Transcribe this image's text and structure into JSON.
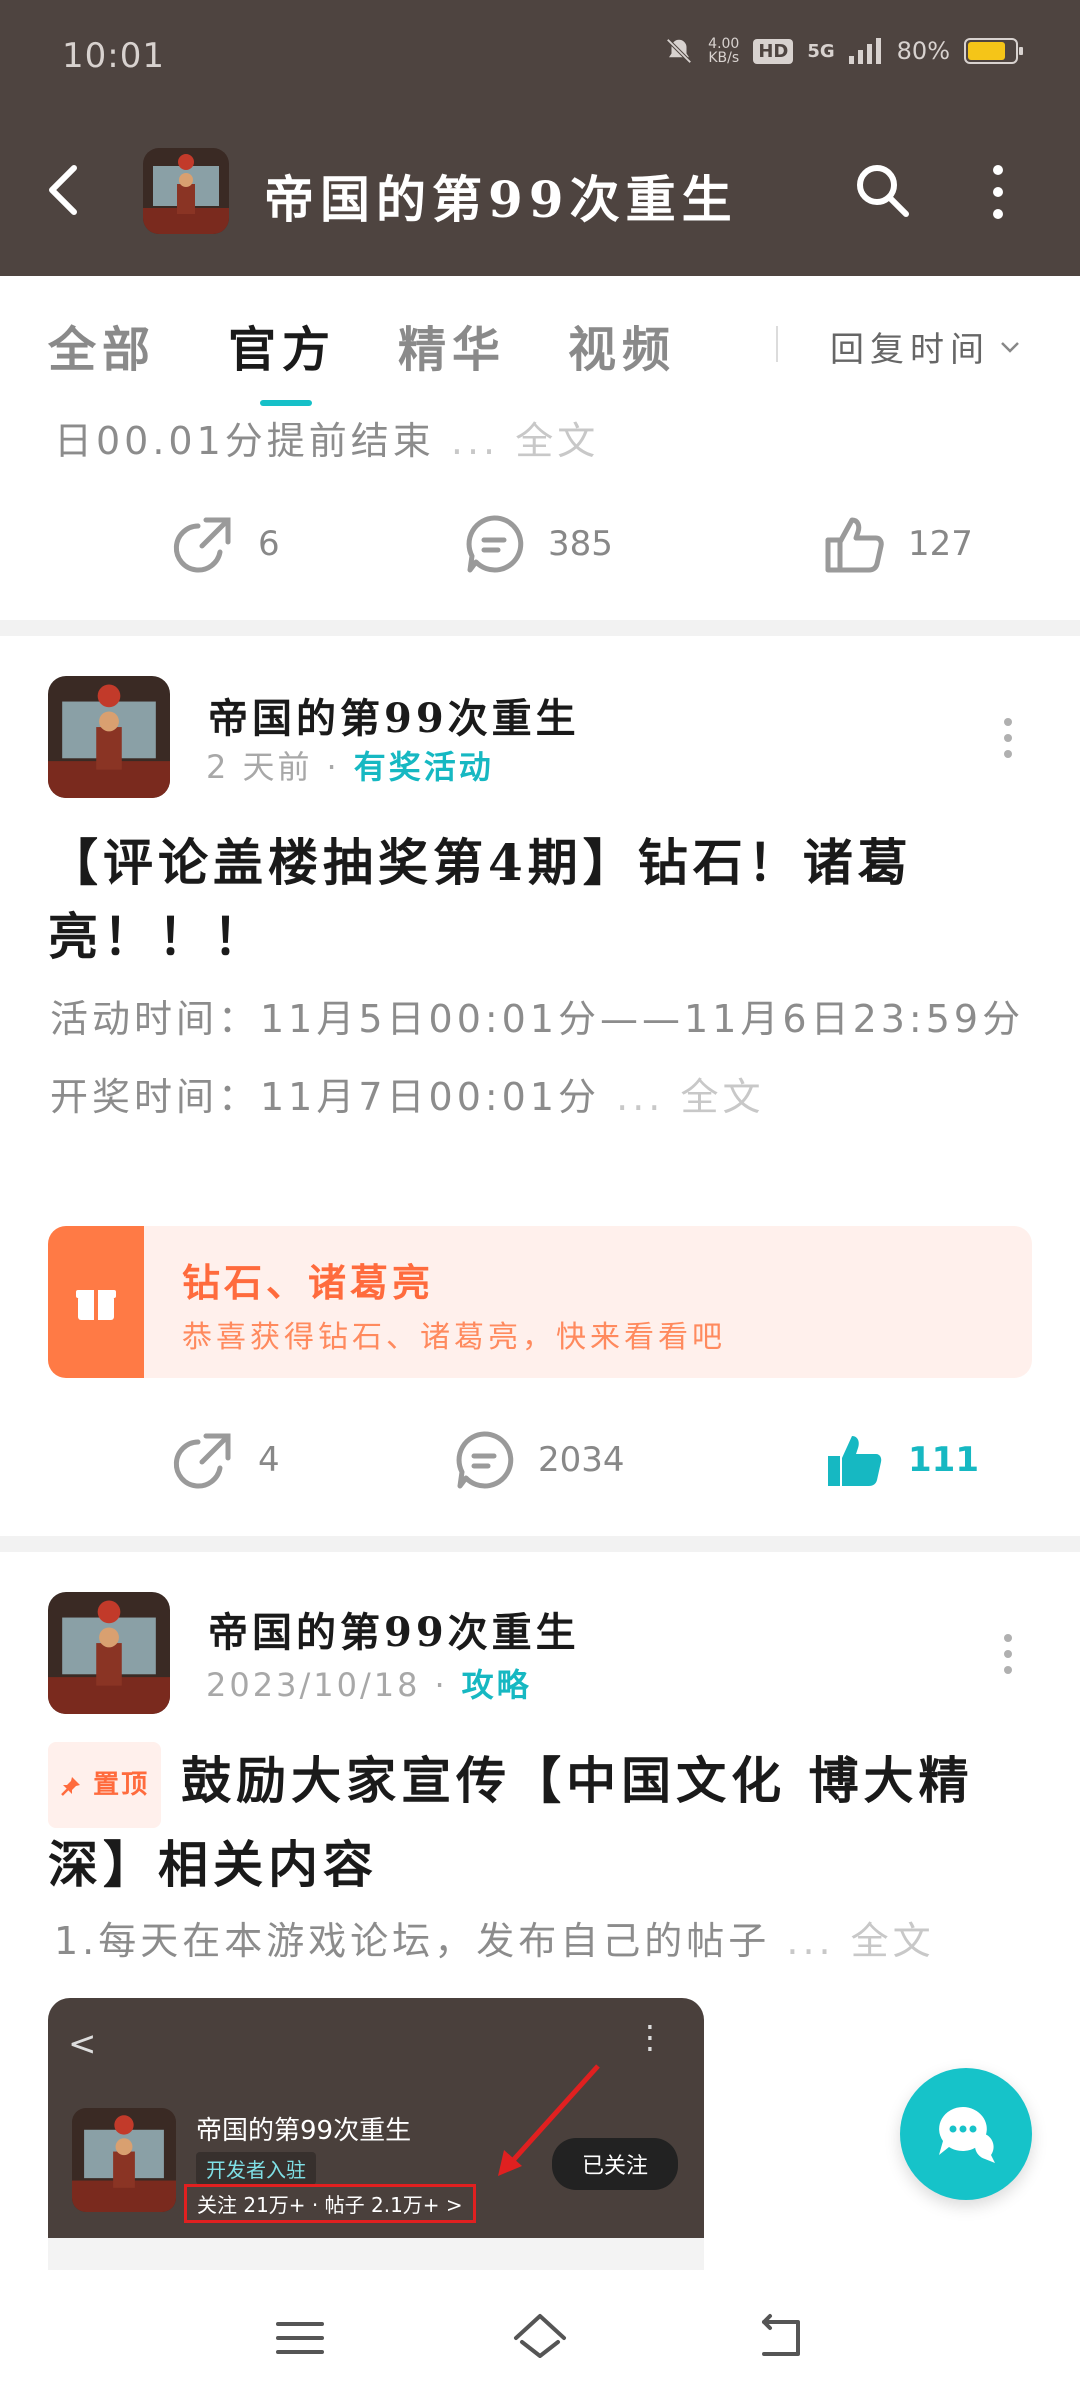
{
  "status": {
    "time": "10:01",
    "speed": "4.00\nKB/s",
    "hd": "HD",
    "network": "5G",
    "battery": "80%"
  },
  "header": {
    "title": "帝国的第99次重生"
  },
  "tabs": [
    {
      "label": "全部",
      "active": false
    },
    {
      "label": "官方",
      "active": true
    },
    {
      "label": "精华",
      "active": false
    },
    {
      "label": "视频",
      "active": false
    }
  ],
  "sort_label": "回复时间",
  "prev_post": {
    "excerpt": "日00.01分提前结束",
    "more": "... 全文",
    "shares": "6",
    "comments": "385",
    "likes": "127"
  },
  "post1": {
    "author": "帝国的第99次重生",
    "time": "2 天前",
    "dot": "·",
    "tag": "有奖活动",
    "title": "【评论盖楼抽奖第4期】钻石！诸葛亮！！！",
    "body_line1": "活动时间：11月5日00:01分——11月6日23:59分",
    "body_line2": "开奖时间：11月7日00:01分",
    "more": "... 全文",
    "reward_title": "钻石、诸葛亮",
    "reward_sub": "恭喜获得钻石、诸葛亮，快来看看吧",
    "shares": "4",
    "comments": "2034",
    "likes": "111"
  },
  "post2": {
    "author": "帝国的第99次重生",
    "time": "2023/10/18",
    "dot": "·",
    "tag": "攻略",
    "pin": "置顶",
    "title": "鼓励大家宣传【中国文化 博大精深】相关内容",
    "excerpt": "1.每天在本游戏论坛，发布自己的帖子",
    "more": "... 全文",
    "thumb": {
      "name": "帝国的第99次重生",
      "dev": "开发者入驻",
      "stats": "关注 21万+ · 帖子 2.1万+ >",
      "follow": "已关注"
    }
  },
  "colors": {
    "header_bg": "#4e4440",
    "accent": "#16c0c8",
    "reward": "#ff7a45"
  }
}
